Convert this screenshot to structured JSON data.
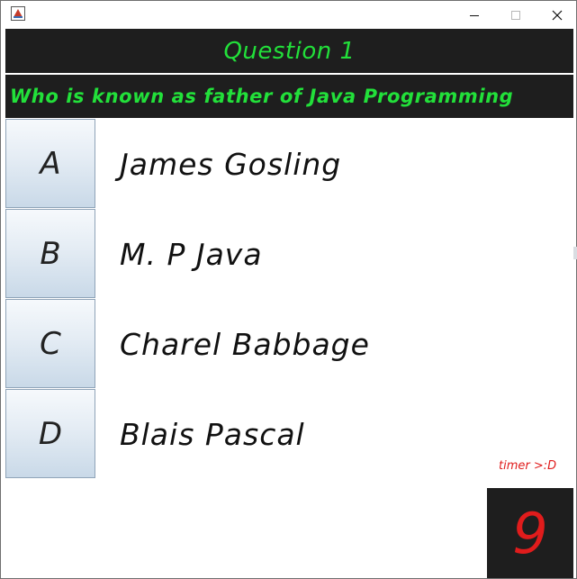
{
  "window": {
    "icons": {
      "app": "java-app-icon",
      "minimize": "minimize-icon",
      "maximize": "maximize-icon",
      "close": "close-icon"
    }
  },
  "quiz": {
    "title": "Question 1",
    "question": "Who is known as father of Java Programming",
    "options": [
      {
        "letter": "A",
        "text": "James Gosling"
      },
      {
        "letter": "B",
        "text": "M. P Java"
      },
      {
        "letter": "C",
        "text": "Charel Babbage"
      },
      {
        "letter": "D",
        "text": "Blais Pascal"
      }
    ],
    "timer_label": "timer >:D",
    "timer_value": "9"
  },
  "colors": {
    "header_bg": "#1e1e1e",
    "header_text": "#22e03a",
    "timer_text": "#e01c1c",
    "button_bg_top": "#f6f9fc",
    "button_bg_bottom": "#c9d9e8"
  }
}
